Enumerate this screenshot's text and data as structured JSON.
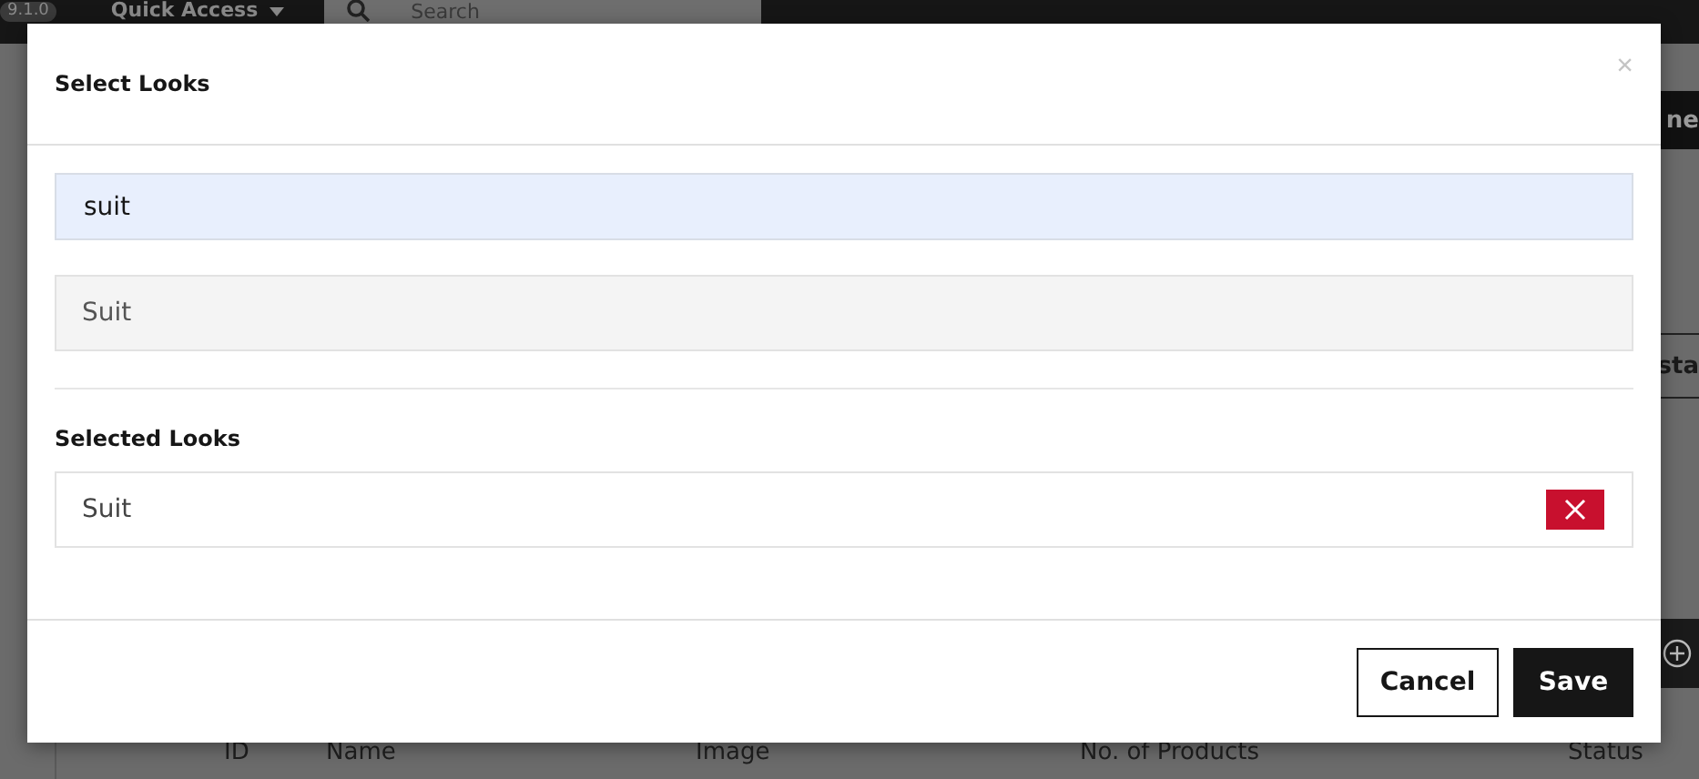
{
  "background": {
    "version": "9.1.0",
    "quick_access": "Quick Access",
    "search": {
      "placeholder": "Search"
    },
    "right_header": "ne",
    "right_column": "sta",
    "table": {
      "columns": [
        "ID",
        "Name",
        "Image",
        "No. of Products",
        "Status"
      ]
    }
  },
  "dialog": {
    "title": "Select Looks",
    "close": "×",
    "search": {
      "value": "suit"
    },
    "results": [
      {
        "label": "Suit"
      }
    ],
    "selected_title": "Selected Looks",
    "selected": [
      {
        "label": "Suit"
      }
    ],
    "buttons": [
      {
        "label": "Cancel",
        "kind": "secondary"
      },
      {
        "label": "Save",
        "kind": "primary"
      }
    ]
  }
}
